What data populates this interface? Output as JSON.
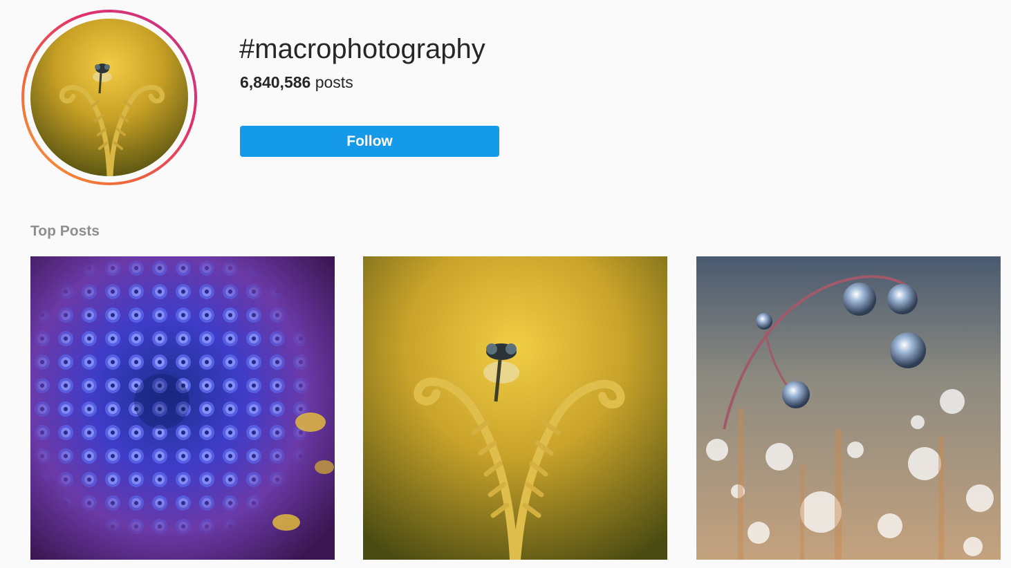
{
  "header": {
    "hashtag": "#macrophotography",
    "post_count": "6,840,586",
    "post_count_label": "posts",
    "follow_label": "Follow"
  },
  "top_posts": {
    "title": "Top Posts",
    "items": [
      {
        "subject": "purple-flower-macro-photo"
      },
      {
        "subject": "damselfly-on-fern-macro-photo"
      },
      {
        "subject": "dew-drops-on-grass-macro-photo"
      }
    ]
  },
  "colors": {
    "follow_button": "#1599e9",
    "section_title": "#8e8e8e",
    "text": "#262626",
    "background": "#fafafa"
  }
}
